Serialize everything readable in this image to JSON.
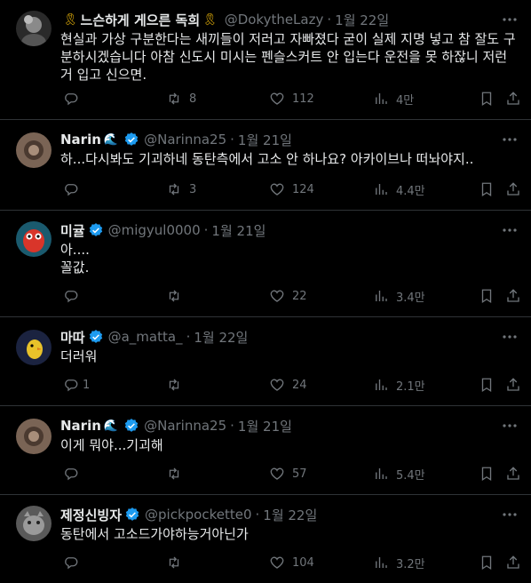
{
  "tweets": [
    {
      "name": "느슨하게 게으른 독희",
      "ribbons": true,
      "verified": false,
      "handle": "@DokytheLazy",
      "time": "1월 22일",
      "text": "현실과 가상 구분한다는 새끼들이 저러고 자빠졌다 굳이 실제 지명 넣고 참 잘도 구분하시겠습니다 아참 신도시 미시는 펜슬스커트 안 입는다 운전을 못 하잖니 저런 거 입고 신으면.",
      "replies": "",
      "retweets": "8",
      "likes": "112",
      "views": "4만"
    },
    {
      "name": "Narin",
      "ribbons": false,
      "verified": true,
      "handle": "@Narinna25",
      "time": "1월 21일",
      "text": "하...다시봐도 기괴하네 동탄측에서 고소 안 하나요? 아카이브나 떠놔야지..",
      "replies": "",
      "retweets": "3",
      "likes": "124",
      "views": "4.4만"
    },
    {
      "name": "미귤",
      "ribbons": false,
      "verified": true,
      "handle": "@migyul0000",
      "time": "1월 21일",
      "text": "아....\n꼴값.",
      "replies": "",
      "retweets": "",
      "likes": "22",
      "views": "3.4만"
    },
    {
      "name": "마따",
      "ribbons": false,
      "verified": true,
      "handle": "@a_matta_",
      "time": "1월 22일",
      "text": "더러워",
      "replies": "1",
      "retweets": "",
      "likes": "24",
      "views": "2.1만"
    },
    {
      "name": "Narin",
      "ribbons": false,
      "verified": true,
      "handle": "@Narinna25",
      "time": "1월 21일",
      "text": "이게 뭐야...기괴해",
      "replies": "",
      "retweets": "",
      "likes": "57",
      "views": "5.4만"
    },
    {
      "name": "제정신빙자",
      "ribbons": false,
      "verified": true,
      "handle": "@pickpockette0",
      "time": "1월 22일",
      "text": "동탄에서 고소드가야하능거아닌가",
      "replies": "",
      "retweets": "",
      "likes": "104",
      "views": "3.2만"
    }
  ],
  "icons": {
    "reply": "reply-icon",
    "retweet": "retweet-icon",
    "like": "heart-icon",
    "views": "views-icon",
    "bookmark": "bookmark-icon",
    "share": "share-icon",
    "more": "more-icon",
    "verified": "verified-badge-icon",
    "ribbon": "yellow-ribbon-icon"
  },
  "colors": {
    "background": "#000000",
    "text": "#e7e9ea",
    "muted": "#71767b",
    "divider": "#2f3336",
    "verified": "#1d9bf0",
    "ribbon": "#f0b90b"
  }
}
